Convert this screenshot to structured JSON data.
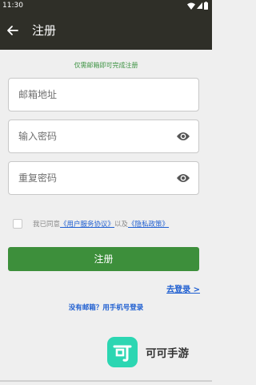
{
  "status_bar": {
    "time": "11:30",
    "icons": [
      "wifi-icon",
      "signal-icon",
      "battery-icon"
    ]
  },
  "app_bar": {
    "back_icon": "arrow-left-icon",
    "title": "注册"
  },
  "form": {
    "hint": "仅需邮箱即可完成注册",
    "email_placeholder": "邮箱地址",
    "password_placeholder": "输入密码",
    "confirm_placeholder": "重复密码",
    "visibility_icon": "eye-icon",
    "agree_prefix": "我已同意",
    "agree_link_terms": "《用户服务协议》",
    "agree_and": "以及",
    "agree_link_privacy": "《隐私政策》",
    "agree_checked": false,
    "submit_label": "注册"
  },
  "links": {
    "login": "去登录 >",
    "phone_register": "没有邮箱？用手机号登录"
  },
  "brand": {
    "logo_glyph": "可",
    "name": "可可手游"
  },
  "colors": {
    "app_bar": "#2f2f28",
    "accent_green": "#3d8f3b",
    "link_blue": "#1f5fd1",
    "logo_teal": "#2cd6b2"
  }
}
